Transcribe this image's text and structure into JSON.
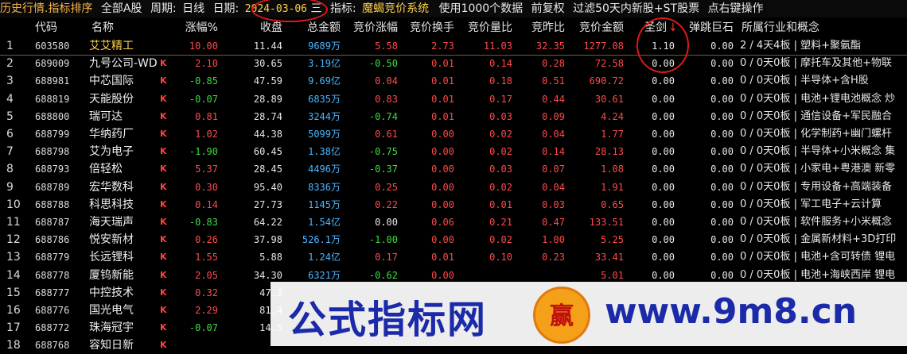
{
  "topbar": {
    "mode": "历史行情.指标排序",
    "scope": "全部A股",
    "period_label": "周期:",
    "period_value": "日线",
    "date_label": "日期:",
    "date_value": "2024-03-06",
    "weekday": "三",
    "indicator_label": "指标:",
    "indicator_value": "魔蝎竞价系统",
    "data_note": "使用1000个数据",
    "adjust": "前复权",
    "filter": "过滤50天内新股+ST股票",
    "rightclick": "点右键操作"
  },
  "columns": {
    "code": "代码",
    "name": "名称",
    "chg": "涨幅%",
    "close": "收盘",
    "amount": "总金额",
    "auc_chg": "竞价涨幅",
    "auc_turn": "竞价换手",
    "auc_ratio": "竞价量比",
    "auc_prev": "竞昨比",
    "auc_amt": "竞价金额",
    "sword": "圣剑",
    "sword_arrow": "↓",
    "bounce": "弹跳巨石",
    "industry": "所属行业和概念"
  },
  "rows": [
    {
      "idx": "1",
      "code": "603580",
      "name": "艾艾精工",
      "k": "",
      "chg": "10.00",
      "close": "11.44",
      "amt": "9689万",
      "auc_chg": "5.58",
      "auc_turn": "2.73",
      "auc_ratio": "11.03",
      "auc_prev": "32.35",
      "auc_amt": "1277.08",
      "sword": "1.10",
      "bounce": "0.00",
      "ind": "2 / 4天4板 | 塑料+聚氨酯"
    },
    {
      "idx": "2",
      "code": "689009",
      "name": "九号公司-WD",
      "k": "K",
      "chg": "2.10",
      "close": "30.65",
      "amt": "3.19亿",
      "auc_chg": "-0.50",
      "auc_turn": "0.01",
      "auc_ratio": "0.14",
      "auc_prev": "0.28",
      "auc_amt": "72.58",
      "sword": "0.00",
      "bounce": "0.00",
      "ind": "0 / 0天0板 | 摩托车及其他+物联"
    },
    {
      "idx": "3",
      "code": "688981",
      "name": "中芯国际",
      "k": "K",
      "chg": "-0.85",
      "close": "47.59",
      "amt": "9.69亿",
      "auc_chg": "0.04",
      "auc_turn": "0.01",
      "auc_ratio": "0.18",
      "auc_prev": "0.51",
      "auc_amt": "690.72",
      "sword": "0.00",
      "bounce": "0.00",
      "ind": "0 / 0天0板 | 半导体+含H股"
    },
    {
      "idx": "4",
      "code": "688819",
      "name": "天能股份",
      "k": "K",
      "chg": "-0.07",
      "close": "28.89",
      "amt": "6835万",
      "auc_chg": "0.83",
      "auc_turn": "0.01",
      "auc_ratio": "0.17",
      "auc_prev": "0.44",
      "auc_amt": "30.61",
      "sword": "0.00",
      "bounce": "0.00",
      "ind": "0 / 0天0板 | 电池+锂电池概念 炒"
    },
    {
      "idx": "5",
      "code": "688800",
      "name": "瑞可达",
      "k": "K",
      "chg": "0.81",
      "close": "28.74",
      "amt": "3244万",
      "auc_chg": "-0.74",
      "auc_turn": "0.01",
      "auc_ratio": "0.03",
      "auc_prev": "0.09",
      "auc_amt": "4.24",
      "sword": "0.00",
      "bounce": "0.00",
      "ind": "0 / 0天0板 | 通信设备+军民融合"
    },
    {
      "idx": "6",
      "code": "688799",
      "name": "华纳药厂",
      "k": "K",
      "chg": "1.02",
      "close": "44.38",
      "amt": "5099万",
      "auc_chg": "0.61",
      "auc_turn": "0.00",
      "auc_ratio": "0.02",
      "auc_prev": "0.04",
      "auc_amt": "1.77",
      "sword": "0.00",
      "bounce": "0.00",
      "ind": "0 / 0天0板 | 化学制药+幽门螺杆"
    },
    {
      "idx": "7",
      "code": "688798",
      "name": "艾为电子",
      "k": "K",
      "chg": "-1.90",
      "close": "60.45",
      "amt": "1.38亿",
      "auc_chg": "-0.75",
      "auc_turn": "0.00",
      "auc_ratio": "0.02",
      "auc_prev": "0.14",
      "auc_amt": "28.13",
      "sword": "0.00",
      "bounce": "0.00",
      "ind": "0 / 0天0板 | 半导体+小米概念 集"
    },
    {
      "idx": "8",
      "code": "688793",
      "name": "倍轻松",
      "k": "K",
      "chg": "5.37",
      "close": "28.45",
      "amt": "4496万",
      "auc_chg": "-0.37",
      "auc_turn": "0.00",
      "auc_ratio": "0.03",
      "auc_prev": "0.07",
      "auc_amt": "1.08",
      "sword": "0.00",
      "bounce": "0.00",
      "ind": "0 / 0天0板 | 小家电+粤港澳 新零"
    },
    {
      "idx": "9",
      "code": "688789",
      "name": "宏华数科",
      "k": "K",
      "chg": "0.30",
      "close": "95.40",
      "amt": "8336万",
      "auc_chg": "0.25",
      "auc_turn": "0.00",
      "auc_ratio": "0.02",
      "auc_prev": "0.04",
      "auc_amt": "1.91",
      "sword": "0.00",
      "bounce": "0.00",
      "ind": "0 / 0天0板 | 专用设备+高端装备"
    },
    {
      "idx": "10",
      "code": "688788",
      "name": "科思科技",
      "k": "K",
      "chg": "0.14",
      "close": "27.73",
      "amt": "1145万",
      "auc_chg": "0.22",
      "auc_turn": "0.00",
      "auc_ratio": "0.01",
      "auc_prev": "0.03",
      "auc_amt": "0.65",
      "sword": "0.00",
      "bounce": "0.00",
      "ind": "0 / 0天0板 | 军工电子+云计算"
    },
    {
      "idx": "11",
      "code": "688787",
      "name": "海天瑞声",
      "k": "K",
      "chg": "-0.83",
      "close": "64.22",
      "amt": "1.54亿",
      "auc_chg": "0.00",
      "auc_turn": "0.06",
      "auc_ratio": "0.21",
      "auc_prev": "0.47",
      "auc_amt": "133.51",
      "sword": "0.00",
      "bounce": "0.00",
      "ind": "0 / 0天0板 | 软件服务+小米概念"
    },
    {
      "idx": "12",
      "code": "688786",
      "name": "悦安新材",
      "k": "K",
      "chg": "0.26",
      "close": "37.98",
      "amt": "526.1万",
      "auc_chg": "-1.00",
      "auc_turn": "0.00",
      "auc_ratio": "0.02",
      "auc_prev": "1.00",
      "auc_amt": "5.25",
      "sword": "0.00",
      "bounce": "0.00",
      "ind": "0 / 0天0板 | 金属新材料+3D打印"
    },
    {
      "idx": "13",
      "code": "688779",
      "name": "长远锂科",
      "k": "K",
      "chg": "1.55",
      "close": "5.88",
      "amt": "1.24亿",
      "auc_chg": "0.17",
      "auc_turn": "0.01",
      "auc_ratio": "0.10",
      "auc_prev": "0.23",
      "auc_amt": "33.41",
      "sword": "0.00",
      "bounce": "0.00",
      "ind": "0 / 0天0板 | 电池+含可转债 锂电"
    },
    {
      "idx": "14",
      "code": "688778",
      "name": "厦钨新能",
      "k": "K",
      "chg": "2.05",
      "close": "34.30",
      "amt": "6321万",
      "auc_chg": "-0.62",
      "auc_turn": "0.00",
      "auc_ratio": "",
      "auc_prev": "",
      "auc_amt": "5.01",
      "sword": "0.00",
      "bounce": "0.00",
      "ind": "0 / 0天0板 | 电池+海峡西岸 锂电"
    },
    {
      "idx": "15",
      "code": "688777",
      "name": "中控技术",
      "k": "K",
      "chg": "0.32",
      "close": "47.3",
      "amt": "",
      "auc_chg": "",
      "auc_turn": "",
      "auc_ratio": "",
      "auc_prev": "",
      "auc_amt": "",
      "sword": "",
      "bounce": "",
      "ind": ""
    },
    {
      "idx": "16",
      "code": "688776",
      "name": "国光电气",
      "k": "K",
      "chg": "2.29",
      "close": "81.4",
      "amt": "",
      "auc_chg": "",
      "auc_turn": "",
      "auc_ratio": "",
      "auc_prev": "",
      "auc_amt": "",
      "sword": "",
      "bounce": "",
      "ind": ""
    },
    {
      "idx": "17",
      "code": "688772",
      "name": "珠海冠宇",
      "k": "K",
      "chg": "-0.07",
      "close": "14.5",
      "amt": "",
      "auc_chg": "",
      "auc_turn": "",
      "auc_ratio": "",
      "auc_prev": "",
      "auc_amt": "",
      "sword": "",
      "bounce": "",
      "ind": ""
    },
    {
      "idx": "18",
      "code": "688768",
      "name": "容知日新",
      "k": "K",
      "chg": "",
      "close": "",
      "amt": "",
      "auc_chg": "",
      "auc_turn": "",
      "auc_ratio": "",
      "auc_prev": "",
      "auc_amt": "",
      "sword": "",
      "bounce": "",
      "ind": ""
    }
  ],
  "watermark": {
    "text": "公式指标网",
    "logo_char": "赢",
    "url": "www.9m8.cn"
  },
  "colors": {
    "up": "#ff4a4a",
    "down": "#3ddc3d",
    "amount": "#4ab6ff",
    "annotation": "#e01818"
  }
}
